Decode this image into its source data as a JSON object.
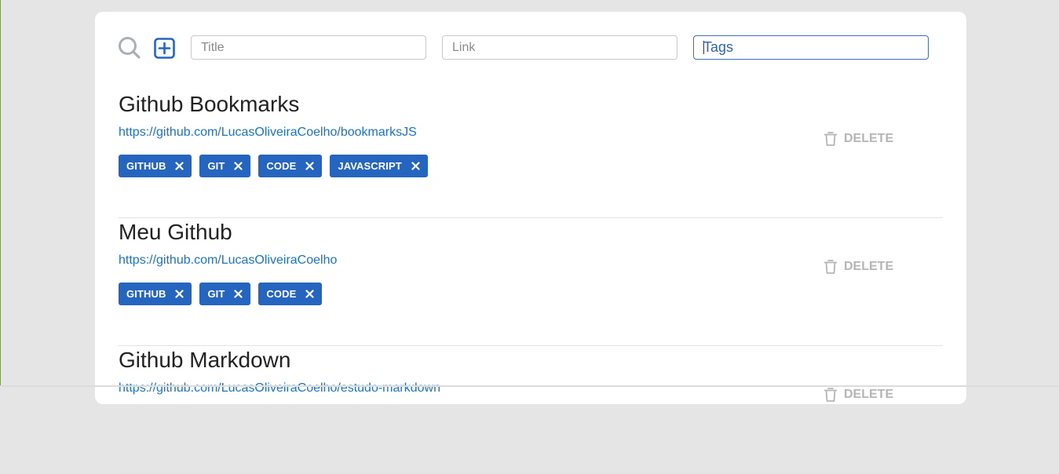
{
  "toolbar": {
    "search_icon": "search-icon",
    "add_icon": "plus-square-icon",
    "title_placeholder": "Title",
    "link_placeholder": "Link",
    "tags_placeholder": "Tags"
  },
  "colors": {
    "accent": "#2565c0",
    "link": "#1a73c8",
    "delete_text": "#b5b5b5",
    "background": "#e5e5e5"
  },
  "bookmarks": [
    {
      "title": "Github Bookmarks",
      "link": "https://github.com/LucasOliveiraCoelho/bookmarksJS",
      "tags": [
        "GITHUB",
        "GIT",
        "CODE",
        "JAVASCRIPT"
      ],
      "delete_label": "DELETE"
    },
    {
      "title": "Meu Github",
      "link": "https://github.com/LucasOliveiraCoelho",
      "tags": [
        "GITHUB",
        "GIT",
        "CODE"
      ],
      "delete_label": "DELETE"
    },
    {
      "title": "Github Markdown",
      "link": "https://github.com/LucasOliveiraCoelho/estudo-markdown",
      "tags": [],
      "delete_label": "DELETE"
    }
  ]
}
